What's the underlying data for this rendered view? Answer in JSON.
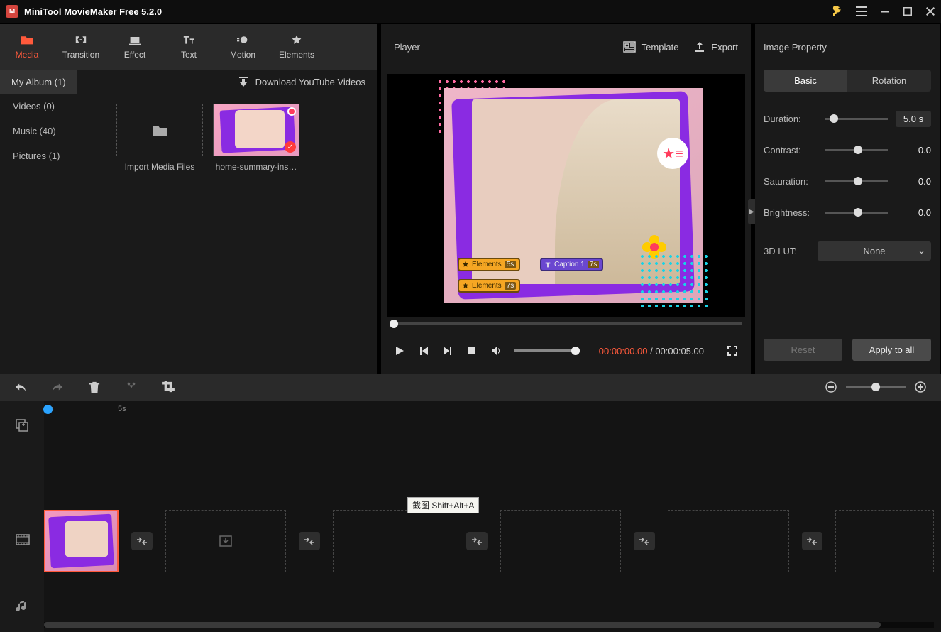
{
  "title": "MiniTool MovieMaker Free 5.2.0",
  "tabs": {
    "media": "Media",
    "transition": "Transition",
    "effect": "Effect",
    "text": "Text",
    "motion": "Motion",
    "elements": "Elements"
  },
  "sub": {
    "my_album": "My Album (1)",
    "download": "Download YouTube Videos"
  },
  "sidebar": {
    "videos": "Videos (0)",
    "music": "Music (40)",
    "pictures": "Pictures (1)"
  },
  "media": {
    "import_label": "Import Media Files",
    "item1_label": "home-summary-ins…"
  },
  "player": {
    "title": "Player",
    "template": "Template",
    "export": "Export",
    "current_time": "00:00:00.00",
    "sep": " / ",
    "total_time": "00:00:05.00",
    "chip_elements": "Elements",
    "chip_caption": "Caption 1",
    "chip_5s": "5s",
    "chip_7s": "7s"
  },
  "props": {
    "panel_title": "Image Property",
    "basic": "Basic",
    "rotation": "Rotation",
    "duration_label": "Duration:",
    "duration_value": "5.0 s",
    "contrast_label": "Contrast:",
    "contrast_value": "0.0",
    "saturation_label": "Saturation:",
    "saturation_value": "0.0",
    "brightness_label": "Brightness:",
    "brightness_value": "0.0",
    "lut_label": "3D LUT:",
    "lut_value": "None",
    "reset": "Reset",
    "apply": "Apply to all"
  },
  "timeline": {
    "t0": "0s",
    "t5": "5s"
  },
  "tooltip": "截图 Shift+Alt+A"
}
